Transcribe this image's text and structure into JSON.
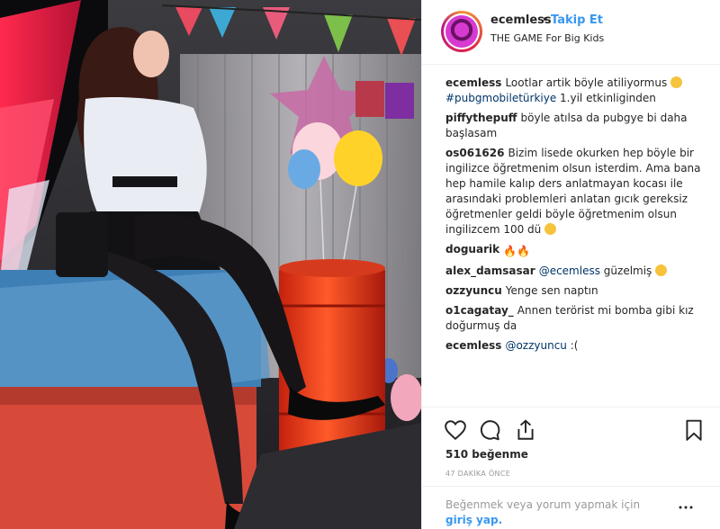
{
  "post": {
    "username": "ecemless",
    "dot": "•",
    "follow_label": "Takip Et",
    "location": "THE GAME For Big Kids"
  },
  "comments": [
    {
      "user": "ecemless",
      "parts": [
        "Lootlar artik böyle atiliyormus ",
        "#pubgmobiletürkiye",
        " 1.yil etkinliginden"
      ]
    },
    {
      "user": "piffythepuff",
      "text": "böyle atılsa da pubgye bi daha başlasam"
    },
    {
      "user": "os061626",
      "text": "Bizim lisede okurken hep böyle bir ingilizce öğretmenim olsun isterdim. Ama bana hep hamile kalıp ders anlatmayan kocası ile arasındaki problemleri anlatan gıcık gereksiz öğretmenler geldi böyle öğretmenim olsun ingilizcem 100 dü"
    },
    {
      "user": "doguarik",
      "text": ""
    },
    {
      "user": "alex_damsasar",
      "mention": "@ecemless",
      "text": "güzelmiş"
    },
    {
      "user": "ozzyuncu",
      "text": "Yenge sen naptın"
    },
    {
      "user": "o1cagatay_",
      "text": "Annen terörist mi bomba gibi kız doğurmuş da"
    },
    {
      "user": "ecemless",
      "mention": "@ozzyuncu",
      "text": ":("
    }
  ],
  "likes": "510 beğenme",
  "time_ago": "47 DAKİKA ÖNCE",
  "login": {
    "prefix": "Beğenmek veya yorum yapmak için",
    "link": "giriş yap.",
    "suffix": ""
  },
  "icons": [
    "heart-icon",
    "comment-icon",
    "share-icon",
    "bookmark-icon"
  ],
  "colors": {
    "link": "#3897f0",
    "text": "#262626",
    "muted": "#999999",
    "mention": "#003569"
  }
}
